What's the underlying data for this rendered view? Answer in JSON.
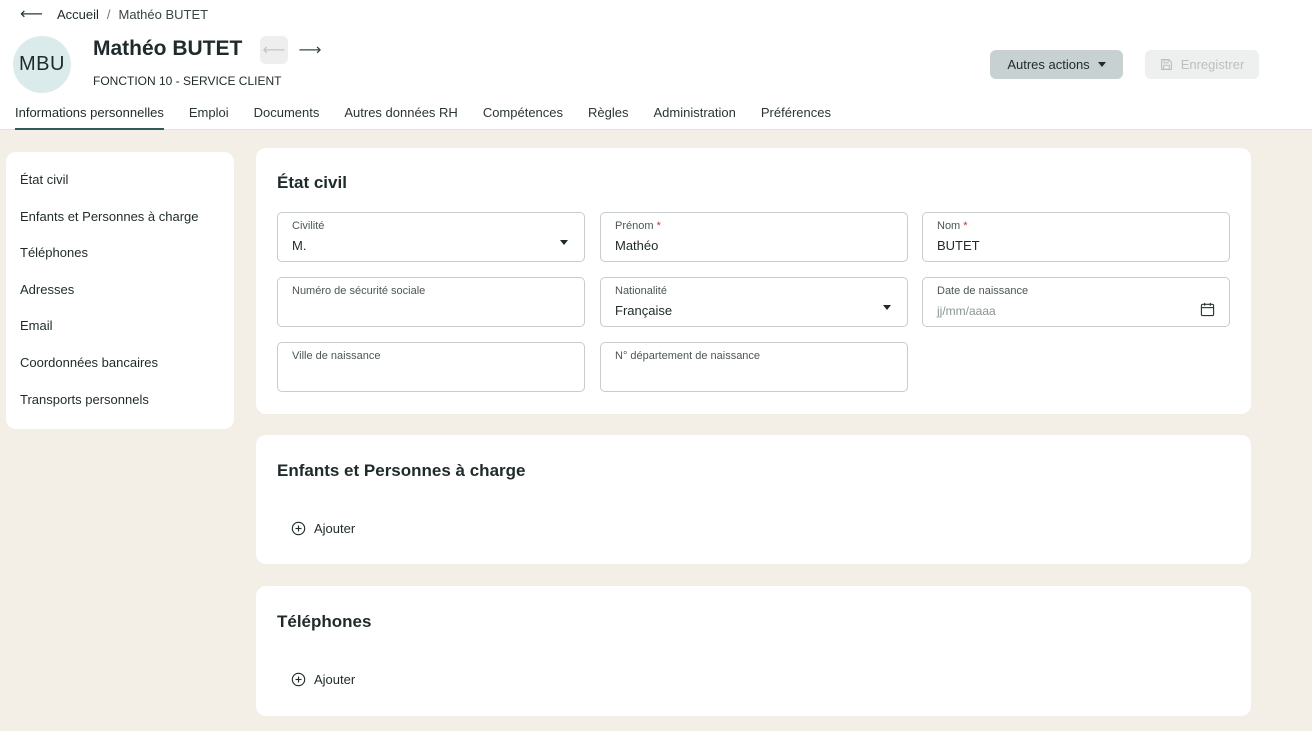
{
  "breadcrumb": {
    "home": "Accueil",
    "separator": "/",
    "current": "Mathéo BUTET"
  },
  "profile": {
    "initials": "MBU",
    "name": "Mathéo BUTET",
    "subtitle": "FONCTION 10 - SERVICE CLIENT"
  },
  "actions": {
    "more_label": "Autres actions",
    "save_label": "Enregistrer"
  },
  "tabs": [
    {
      "label": "Informations personnelles",
      "active": true
    },
    {
      "label": "Emploi"
    },
    {
      "label": "Documents"
    },
    {
      "label": "Autres données RH"
    },
    {
      "label": "Compétences"
    },
    {
      "label": "Règles"
    },
    {
      "label": "Administration"
    },
    {
      "label": "Préférences"
    }
  ],
  "sidebar": {
    "items": [
      {
        "label": "État civil"
      },
      {
        "label": "Enfants et Personnes à charge"
      },
      {
        "label": "Téléphones"
      },
      {
        "label": "Adresses"
      },
      {
        "label": "Email"
      },
      {
        "label": "Coordonnées bancaires"
      },
      {
        "label": "Transports personnels"
      }
    ]
  },
  "etat_civil": {
    "title": "État civil",
    "civilite": {
      "label": "Civilité",
      "value": "M."
    },
    "prenom": {
      "label": "Prénom",
      "required": "*",
      "value": "Mathéo"
    },
    "nom": {
      "label": "Nom",
      "required": "*",
      "value": "BUTET"
    },
    "secu": {
      "label": "Numéro de sécurité sociale",
      "value": ""
    },
    "nationalite": {
      "label": "Nationalité",
      "value": "Française"
    },
    "naissance": {
      "label": "Date de naissance",
      "placeholder": "jj/mm/aaaa"
    },
    "ville": {
      "label": "Ville de naissance",
      "value": ""
    },
    "departement": {
      "label": "N° département de naissance",
      "value": ""
    }
  },
  "enfants": {
    "title": "Enfants et Personnes à charge",
    "add_label": "Ajouter"
  },
  "telephones": {
    "title": "Téléphones",
    "add_label": "Ajouter"
  },
  "colors": {
    "accent": "#2d5a5a",
    "background": "#f4efe6",
    "avatar_bg": "#dbeaea",
    "actions_bg": "#c7d1d1"
  }
}
